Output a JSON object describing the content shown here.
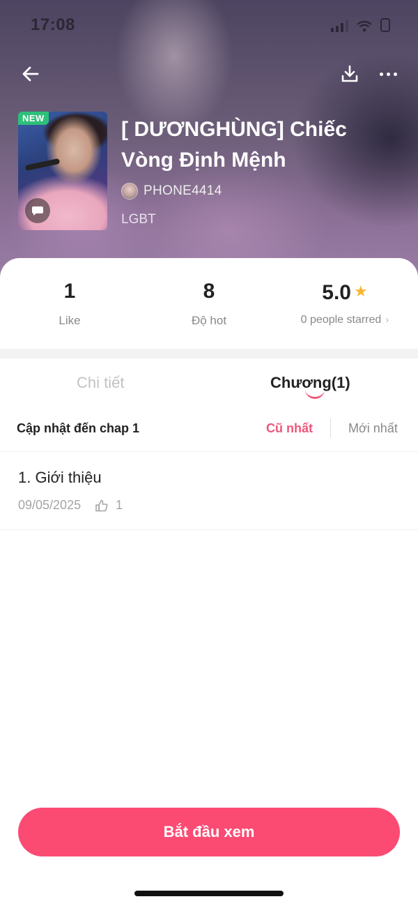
{
  "status_bar": {
    "time": "17:08"
  },
  "header": {
    "badge": "NEW",
    "title": "[ DƯƠNGHÙNG] Chiếc Vòng Định Mệnh",
    "author": "PHONE4414",
    "genre": "LGBT"
  },
  "stats": {
    "likes": {
      "value": "1",
      "label": "Like"
    },
    "hot": {
      "value": "8",
      "label": "Độ hot"
    },
    "rating": {
      "value": "5.0",
      "label": "0 people starred"
    }
  },
  "tabs": {
    "detail": "Chi tiết",
    "chapters": "Chương(1)"
  },
  "chapter_list": {
    "update_info": "Cập nhật đến chap 1",
    "sort_oldest": "Cũ nhất",
    "sort_newest": "Mới nhất",
    "items": [
      {
        "title": "1. Giới thiệu",
        "date": "09/05/2025",
        "likes": "1"
      }
    ]
  },
  "actions": {
    "start_reading": "Bắt đầu xem"
  },
  "colors": {
    "accent": "#fb4b73",
    "badge_new": "#2ec07a",
    "star": "#f7b733"
  }
}
